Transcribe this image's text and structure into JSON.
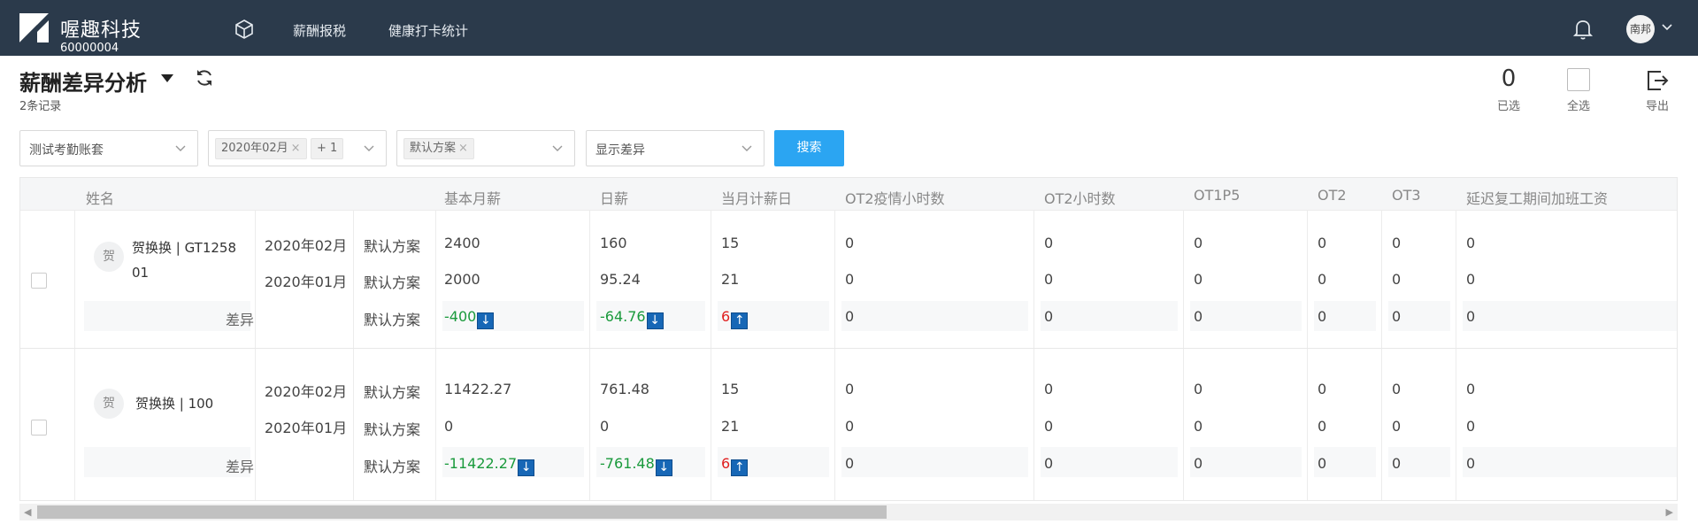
{
  "app": {
    "brand": "喔趣科技",
    "company_id": "60000004",
    "nav": [
      "薪酬报税",
      "健康打卡统计"
    ],
    "user_avatar": "南邦"
  },
  "page": {
    "title": "薪酬差异分析",
    "record_count": "2条记录",
    "selected_count": "0",
    "selected_label": "已选",
    "select_all_label": "全选",
    "export_label": "导出"
  },
  "filters": {
    "account": "测试考勤账套",
    "month_tag": "2020年02月",
    "month_more": "+ 1",
    "plan_tag": "默认方案",
    "display": "显示差异",
    "search_label": "搜索"
  },
  "table": {
    "headers": [
      "姓名",
      "基本月薪",
      "日薪",
      "当月计薪日",
      "OT2疫情小时数",
      "OT2小时数",
      "OT1P5",
      "OT2",
      "OT3",
      "延迟复工期间加班工资"
    ],
    "diff_label": "差异",
    "rows": [
      {
        "avatar": "贺",
        "name_line1": "贺换换 | GT1258",
        "name_line2": "01",
        "months": [
          "2020年02月",
          "2020年01月"
        ],
        "plans": [
          "默认方案",
          "默认方案",
          "默认方案"
        ],
        "basic": [
          "2400",
          "2000",
          "-400"
        ],
        "daily": [
          "160",
          "95.24",
          "-64.76"
        ],
        "days": [
          "15",
          "21",
          "6"
        ],
        "ot2_epidemic": [
          "0",
          "0",
          "0"
        ],
        "ot2_hours": [
          "0",
          "0",
          "0"
        ],
        "ot1p5": [
          "0",
          "0",
          "0"
        ],
        "ot2": [
          "0",
          "0",
          "0"
        ],
        "ot3": [
          "0",
          "0",
          "0"
        ],
        "delay_pay": [
          "0",
          "0",
          "0"
        ]
      },
      {
        "avatar": "贺",
        "name_line1": "贺换换 | 100",
        "name_line2": "",
        "months": [
          "2020年02月",
          "2020年01月"
        ],
        "plans": [
          "默认方案",
          "默认方案",
          "默认方案"
        ],
        "basic": [
          "11422.27",
          "0",
          "-11422.27"
        ],
        "daily": [
          "761.48",
          "0",
          "-761.48"
        ],
        "days": [
          "15",
          "21",
          "6"
        ],
        "ot2_epidemic": [
          "0",
          "0",
          "0"
        ],
        "ot2_hours": [
          "0",
          "0",
          "0"
        ],
        "ot1p5": [
          "0",
          "0",
          "0"
        ],
        "ot2": [
          "0",
          "0",
          "0"
        ],
        "ot3": [
          "0",
          "0",
          "0"
        ],
        "delay_pay": [
          "0",
          "0",
          "0"
        ]
      }
    ]
  },
  "colors": {
    "topbar": "#2b3a4b",
    "accent": "#2ba5f2",
    "decrease": "#1a9a3c",
    "increase": "#e02020",
    "arrow_badge": "#1767b6"
  },
  "icons": [
    "logo-icon",
    "cube-icon",
    "bell-icon",
    "refresh-icon",
    "export-icon",
    "chevron-down-icon",
    "arrow-down-icon",
    "arrow-up-icon"
  ]
}
